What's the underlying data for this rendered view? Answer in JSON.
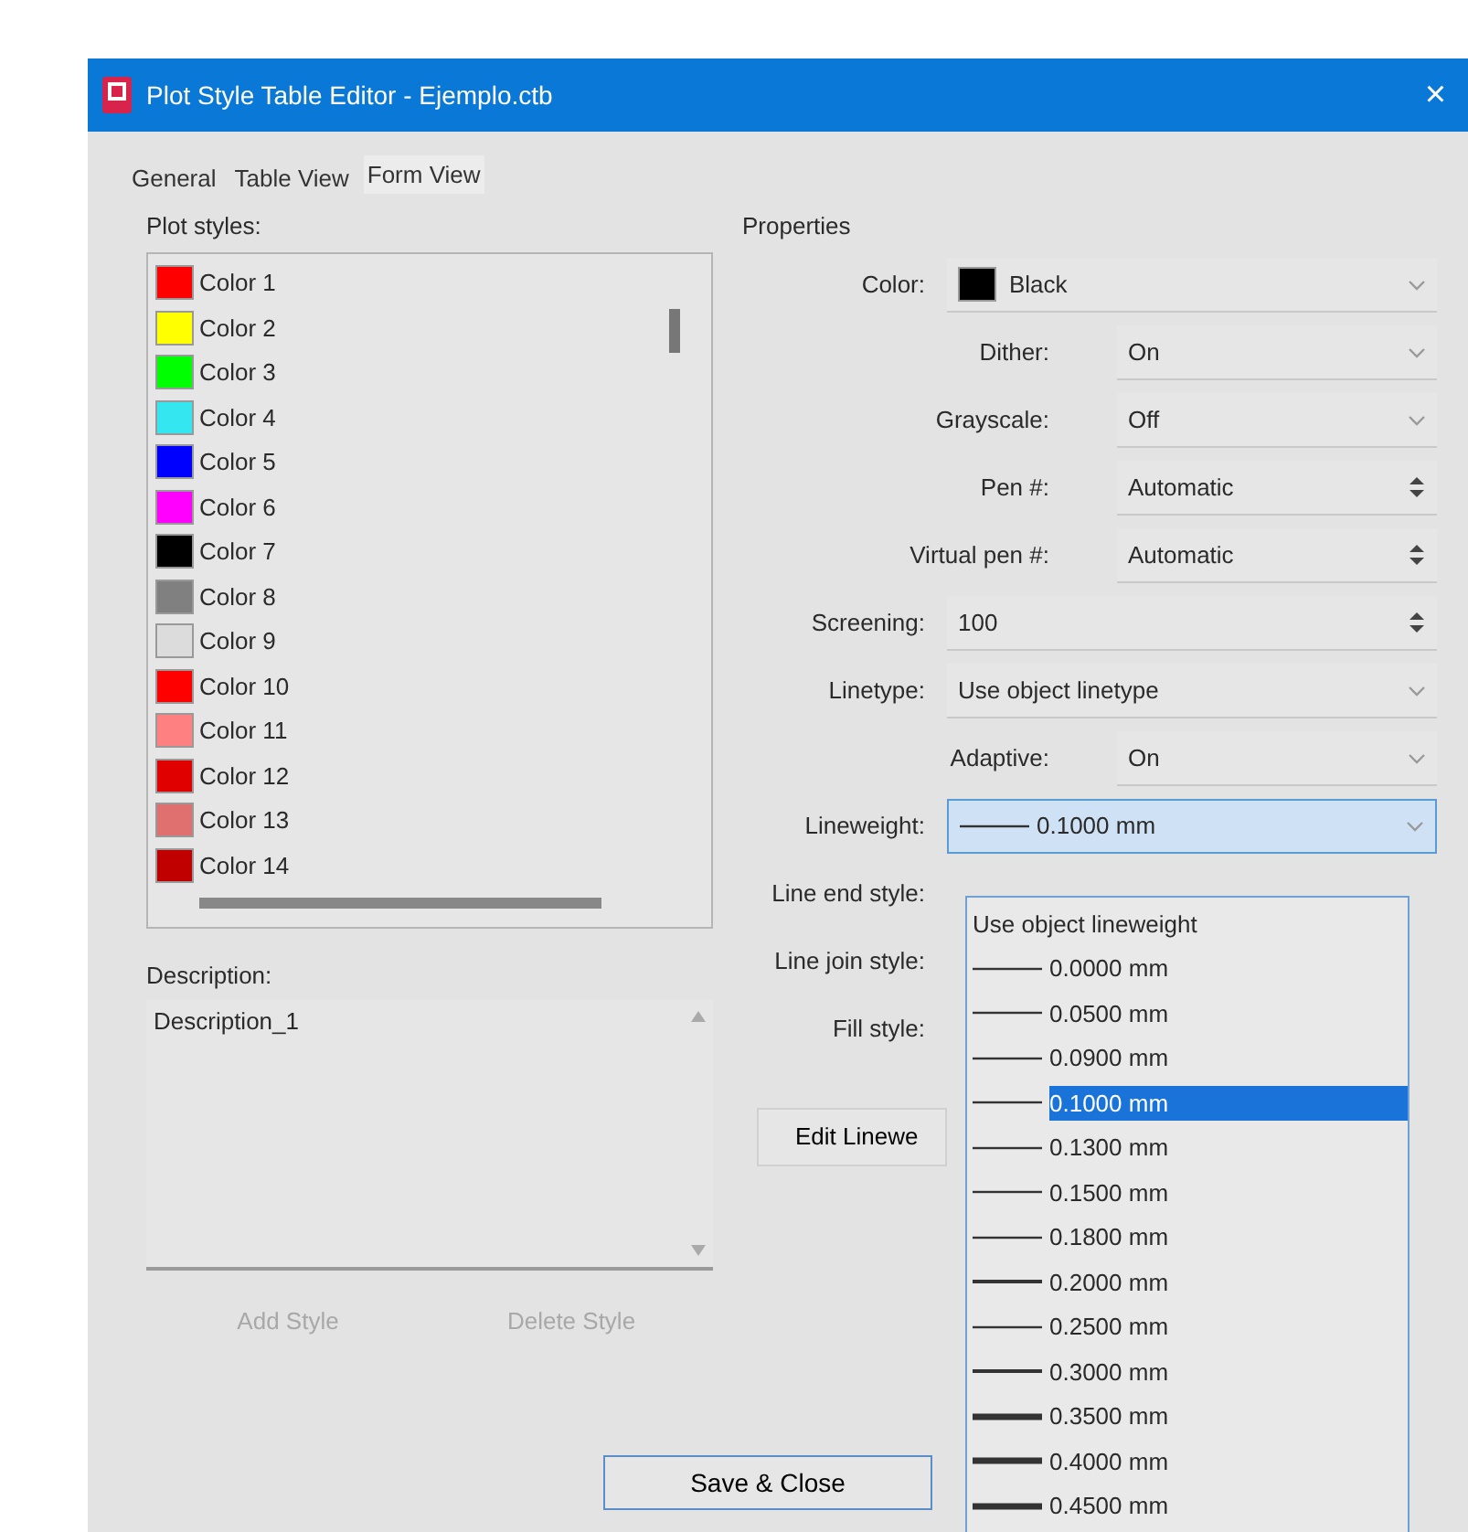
{
  "window": {
    "title": "Plot Style Table Editor - Ejemplo.ctb",
    "close": "×"
  },
  "tabs": [
    {
      "label": "General",
      "selected": false
    },
    {
      "label": "Table View",
      "selected": false
    },
    {
      "label": "Form View",
      "selected": true
    }
  ],
  "plot_styles": {
    "label": "Plot styles:",
    "items": [
      {
        "name": "Color 1",
        "color": "#ff0000"
      },
      {
        "name": "Color 2",
        "color": "#ffff00"
      },
      {
        "name": "Color 3",
        "color": "#00ff00"
      },
      {
        "name": "Color 4",
        "color": "#33e6f0"
      },
      {
        "name": "Color 5",
        "color": "#0000ff"
      },
      {
        "name": "Color 6",
        "color": "#ff00ff"
      },
      {
        "name": "Color 7",
        "color": "#000000"
      },
      {
        "name": "Color 8",
        "color": "#808080"
      },
      {
        "name": "Color 9",
        "color": "#dcdcdc"
      },
      {
        "name": "Color 10",
        "color": "#ff0000"
      },
      {
        "name": "Color 11",
        "color": "#ff8080"
      },
      {
        "name": "Color 12",
        "color": "#e00000"
      },
      {
        "name": "Color 13",
        "color": "#e07070"
      },
      {
        "name": "Color 14",
        "color": "#c00000"
      }
    ]
  },
  "description": {
    "label": "Description:",
    "value": "Description_1"
  },
  "style_buttons": [
    {
      "label": "Add Style",
      "disabled": true
    },
    {
      "label": "Delete Style",
      "disabled": true
    }
  ],
  "properties": {
    "title": "Properties",
    "rows": [
      {
        "label": "Color:",
        "kind": "select",
        "nested": false,
        "value": "Black",
        "color": "#000000"
      },
      {
        "label": "Dither:",
        "kind": "select",
        "nested": true,
        "value": "On"
      },
      {
        "label": "Grayscale:",
        "kind": "select",
        "nested": true,
        "value": "Off"
      },
      {
        "label": "Pen #:",
        "kind": "spin",
        "nested": true,
        "value": "Automatic"
      },
      {
        "label": "Virtual pen #:",
        "kind": "spin",
        "nested": true,
        "value": "Automatic"
      },
      {
        "label": "Screening:",
        "kind": "spin",
        "nested": false,
        "value": "100"
      },
      {
        "label": "Linetype:",
        "kind": "select",
        "nested": false,
        "value": "Use object linetype"
      },
      {
        "label": "Adaptive:",
        "kind": "select",
        "nested": true,
        "value": "On"
      },
      {
        "label": "Lineweight:",
        "kind": "lineselect",
        "nested": false,
        "value": "0.1000 mm",
        "focused": true
      },
      {
        "label": "Line end style:",
        "kind": "covered",
        "nested": false
      },
      {
        "label": "Line join style:",
        "kind": "covered",
        "nested": false
      },
      {
        "label": "Fill style:",
        "kind": "covered",
        "nested": false
      }
    ]
  },
  "edit_button": "Edit Linewe",
  "lineweight_list": [
    {
      "label": "Use object lineweight",
      "kind": "text",
      "selected": false
    },
    {
      "label": "0.0000 mm",
      "kind": "thin",
      "selected": false
    },
    {
      "label": "0.0500 mm",
      "kind": "thin",
      "selected": false
    },
    {
      "label": "0.0900 mm",
      "kind": "thin",
      "selected": false
    },
    {
      "label": "0.1000 mm",
      "kind": "thin",
      "selected": true
    },
    {
      "label": "0.1300 mm",
      "kind": "thin",
      "selected": false
    },
    {
      "label": "0.1500 mm",
      "kind": "thin",
      "selected": false
    },
    {
      "label": "0.1800 mm",
      "kind": "thin",
      "selected": false
    },
    {
      "label": "0.2000 mm",
      "kind": "medium",
      "selected": false
    },
    {
      "label": "0.2500 mm",
      "kind": "thin",
      "selected": false
    },
    {
      "label": "0.3000 mm",
      "kind": "medium",
      "selected": false
    },
    {
      "label": "0.3500 mm",
      "kind": "thick",
      "selected": false
    },
    {
      "label": "0.4000 mm",
      "kind": "thick",
      "selected": false
    },
    {
      "label": "0.4500 mm",
      "kind": "thick",
      "selected": false
    }
  ],
  "save_button": "Save & Close"
}
